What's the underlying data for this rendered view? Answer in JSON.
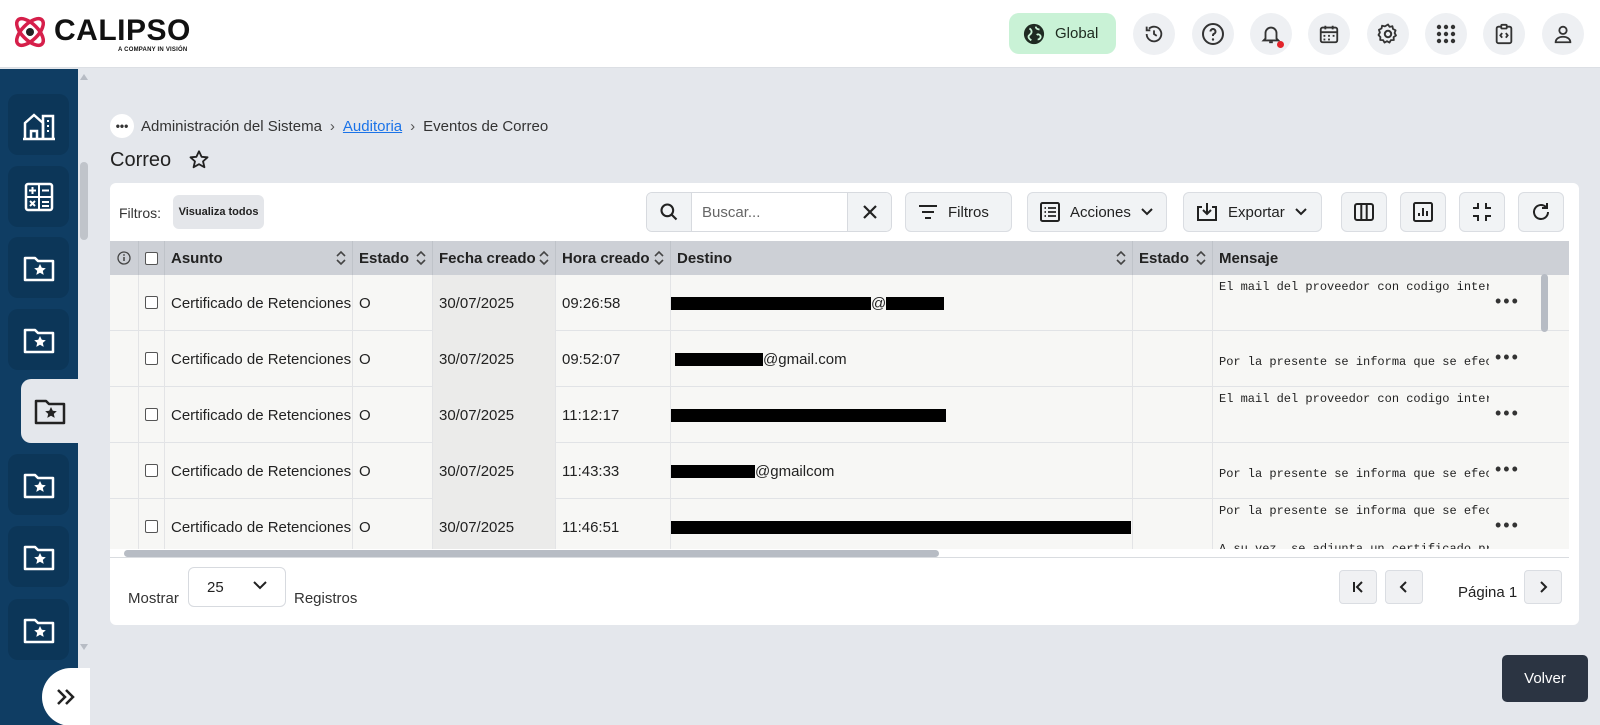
{
  "header": {
    "logo_text": "CALIPSO",
    "logo_sub": "A COMPANY IN VISIÓN",
    "global_label": "Global",
    "icons": [
      "history-icon",
      "help-icon",
      "bell-icon",
      "calendar-icon",
      "gear-icon",
      "apps-grid-icon",
      "code-clipboard-icon",
      "user-icon"
    ],
    "notification_dot_color": "#e3242b"
  },
  "sidebar": {
    "bg_color": "#0f3d63",
    "items": [
      "buildings-icon",
      "calculator-icon",
      "folder-star-icon",
      "folder-star-icon",
      "folder-star-icon",
      "folder-star-icon",
      "folder-star-icon",
      "folder-star-icon"
    ],
    "active_index": 4
  },
  "breadcrumb": {
    "items": [
      "Administración del Sistema",
      "Auditoria",
      "Eventos de Correo"
    ],
    "link_index": 1
  },
  "page": {
    "title": "Correo"
  },
  "toolbar": {
    "filters_label": "Filtros:",
    "filter_chip": "Visualiza todos",
    "search_placeholder": "Buscar...",
    "filtros_btn": "Filtros",
    "acciones_btn": "Acciones",
    "exportar_btn": "Exportar"
  },
  "table": {
    "columns": [
      "Asunto",
      "Estado",
      "Fecha creado",
      "Hora creado",
      "Destino",
      "Estado",
      "Mensaje"
    ],
    "rows": [
      {
        "asunto": "Certificado de Retenciones",
        "estado": "O",
        "fecha": "30/07/2025",
        "hora": "09:26:58",
        "destino_suffix": "@",
        "mensaje": "El mail del proveedor con codigo intern"
      },
      {
        "asunto": "Certificado de Retenciones",
        "estado": "O",
        "fecha": "30/07/2025",
        "hora": "09:52:07",
        "destino_suffix": "@gmail.com",
        "mensaje": "\nPor la presente se informa que se efec\n\nA su vez, se adjunta un certificado pro"
      },
      {
        "asunto": "Certificado de Retenciones",
        "estado": "O",
        "fecha": "30/07/2025",
        "hora": "11:12:17",
        "destino_suffix": "",
        "mensaje": "El mail del proveedor con codigo intern"
      },
      {
        "asunto": "Certificado de Retenciones",
        "estado": "O",
        "fecha": "30/07/2025",
        "hora": "11:43:33",
        "destino_suffix": "@gmailcom",
        "mensaje": "\nPor la presente se informa que se efec\n\nA su vez, se adjunta un certificado pro"
      },
      {
        "asunto": "Certificado de Retenciones",
        "estado": "O",
        "fecha": "30/07/2025",
        "hora": "11:46:51",
        "destino_suffix": "",
        "mensaje": "Por la presente se informa que se efec\n\nA su vez, se adjunta un certificado pro"
      }
    ]
  },
  "footer": {
    "show_label": "Mostrar",
    "page_size": "25",
    "records_label": "Registros",
    "page_label": "Página 1"
  },
  "actions": {
    "volver": "Volver"
  }
}
